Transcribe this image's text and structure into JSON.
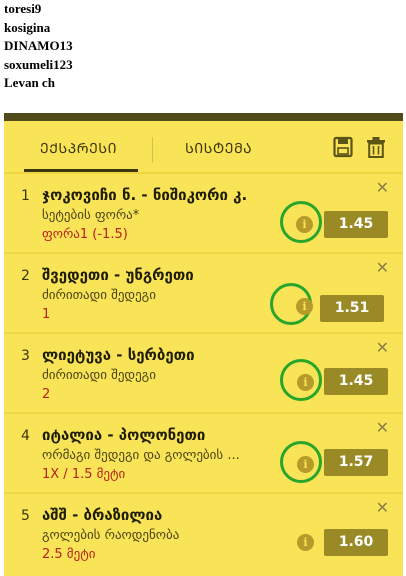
{
  "users": [
    "toresi9",
    "kosigina",
    "DINAMO13",
    "soxumeli123",
    "Levan ch"
  ],
  "tabs": {
    "express": "ᲔᲥᲡᲞᲠᲔᲡᲘ",
    "system": "ᲡᲘᲡᲢᲔᲛᲐ"
  },
  "colors": {
    "panel": "#f8e456",
    "odds_bg": "#9a8a25",
    "pick_text": "#b5231a",
    "highlight": "#2aa52c"
  },
  "icons": {
    "save": "save-icon",
    "trash": "trash-icon",
    "info": "info-icon",
    "close": "close-icon"
  },
  "bets": [
    {
      "num": "1",
      "match": "ჯოკოვიჩი ნ. - ნიშიკორი კ.",
      "market": "სეტების ფორა*",
      "pick": "ფორა1 (-1.5)",
      "odds": "1.45"
    },
    {
      "num": "2",
      "match": "შვედეთი - უნგრეთი",
      "market": "ძირითადი შედეგი",
      "pick": "1",
      "odds": "1.51"
    },
    {
      "num": "3",
      "match": "ლიეტუვა - სერბეთი",
      "market": "ძირითადი შედეგი",
      "pick": "2",
      "odds": "1.45"
    },
    {
      "num": "4",
      "match": "იტალია - პოლონეთი",
      "market": "ორმაგი შედეგი და გოლების ...",
      "pick": "1X / 1.5 მეტი",
      "odds": "1.57"
    },
    {
      "num": "5",
      "match": "აშშ - ბრაზილია",
      "market": "გოლების რაოდენობა",
      "pick": "2.5 მეტი",
      "odds": "1.60"
    }
  ],
  "close_glyph": "✕",
  "info_glyph": "i"
}
